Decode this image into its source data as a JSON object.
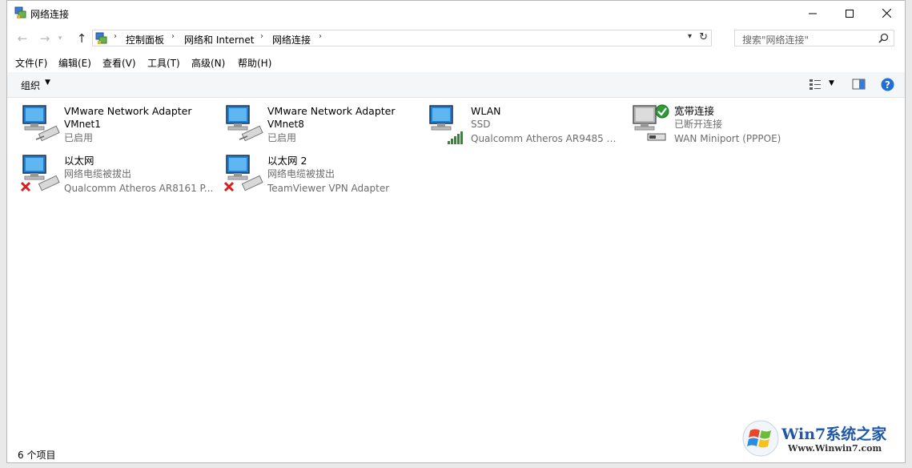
{
  "window": {
    "title": "网络连接"
  },
  "address": {
    "crumbs": [
      "控制面板",
      "网络和 Internet",
      "网络连接"
    ]
  },
  "search": {
    "placeholder": "搜索\"网络连接\""
  },
  "menu": [
    "文件(F)",
    "编辑(E)",
    "查看(V)",
    "工具(T)",
    "高级(N)",
    "帮助(H)"
  ],
  "toolbar": {
    "organize": "组织"
  },
  "connections": [
    {
      "name": "VMware Network Adapter",
      "name2": "VMnet1",
      "status": "已启用",
      "device": "",
      "badge": "cable"
    },
    {
      "name": "VMware Network Adapter",
      "name2": "VMnet8",
      "status": "已启用",
      "device": "",
      "badge": "cable"
    },
    {
      "name": "WLAN",
      "name2": "",
      "status": "SSD",
      "device": "Qualcomm Atheros AR9485 W...",
      "badge": "signal"
    },
    {
      "name": "宽带连接",
      "name2": "",
      "status": "已断开连接",
      "device": "WAN Miniport (PPPOE)",
      "badge": "modem"
    },
    {
      "name": "以太网",
      "name2": "",
      "status": "网络电缆被拔出",
      "device": "Qualcomm Atheros AR8161 P...",
      "badge": "x-cable"
    },
    {
      "name": "以太网 2",
      "name2": "",
      "status": "网络电缆被拔出",
      "device": "TeamViewer VPN Adapter",
      "badge": "x-cable"
    }
  ],
  "status": {
    "count": "6 个项目"
  },
  "watermark": {
    "brand": "Win7系统之家",
    "url": "Www.Winwin7.com"
  }
}
